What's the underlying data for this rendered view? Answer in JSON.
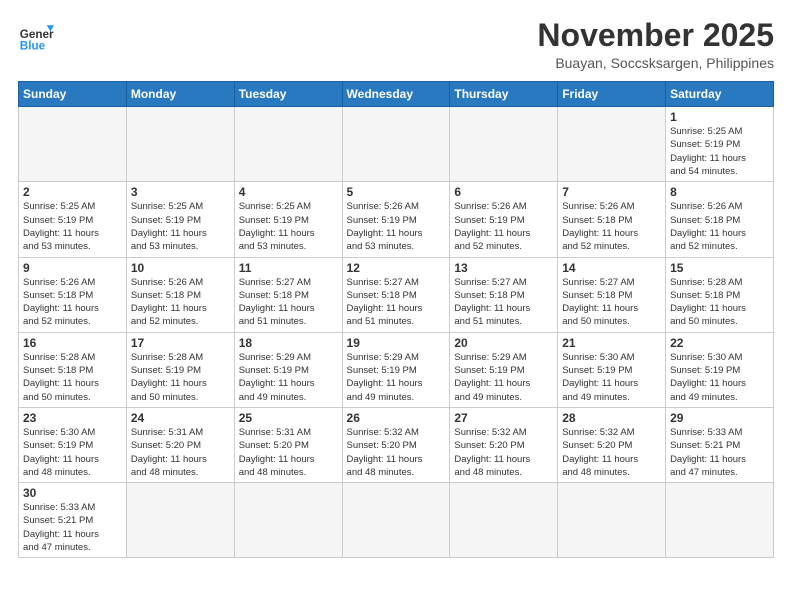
{
  "header": {
    "logo_general": "General",
    "logo_blue": "Blue",
    "month_title": "November 2025",
    "location": "Buayan, Soccsksargen, Philippines"
  },
  "weekdays": [
    "Sunday",
    "Monday",
    "Tuesday",
    "Wednesday",
    "Thursday",
    "Friday",
    "Saturday"
  ],
  "weeks": [
    [
      {
        "day": "",
        "info": ""
      },
      {
        "day": "",
        "info": ""
      },
      {
        "day": "",
        "info": ""
      },
      {
        "day": "",
        "info": ""
      },
      {
        "day": "",
        "info": ""
      },
      {
        "day": "",
        "info": ""
      },
      {
        "day": "1",
        "info": "Sunrise: 5:25 AM\nSunset: 5:19 PM\nDaylight: 11 hours\nand 54 minutes."
      }
    ],
    [
      {
        "day": "2",
        "info": "Sunrise: 5:25 AM\nSunset: 5:19 PM\nDaylight: 11 hours\nand 53 minutes."
      },
      {
        "day": "3",
        "info": "Sunrise: 5:25 AM\nSunset: 5:19 PM\nDaylight: 11 hours\nand 53 minutes."
      },
      {
        "day": "4",
        "info": "Sunrise: 5:25 AM\nSunset: 5:19 PM\nDaylight: 11 hours\nand 53 minutes."
      },
      {
        "day": "5",
        "info": "Sunrise: 5:26 AM\nSunset: 5:19 PM\nDaylight: 11 hours\nand 53 minutes."
      },
      {
        "day": "6",
        "info": "Sunrise: 5:26 AM\nSunset: 5:19 PM\nDaylight: 11 hours\nand 52 minutes."
      },
      {
        "day": "7",
        "info": "Sunrise: 5:26 AM\nSunset: 5:18 PM\nDaylight: 11 hours\nand 52 minutes."
      },
      {
        "day": "8",
        "info": "Sunrise: 5:26 AM\nSunset: 5:18 PM\nDaylight: 11 hours\nand 52 minutes."
      }
    ],
    [
      {
        "day": "9",
        "info": "Sunrise: 5:26 AM\nSunset: 5:18 PM\nDaylight: 11 hours\nand 52 minutes."
      },
      {
        "day": "10",
        "info": "Sunrise: 5:26 AM\nSunset: 5:18 PM\nDaylight: 11 hours\nand 52 minutes."
      },
      {
        "day": "11",
        "info": "Sunrise: 5:27 AM\nSunset: 5:18 PM\nDaylight: 11 hours\nand 51 minutes."
      },
      {
        "day": "12",
        "info": "Sunrise: 5:27 AM\nSunset: 5:18 PM\nDaylight: 11 hours\nand 51 minutes."
      },
      {
        "day": "13",
        "info": "Sunrise: 5:27 AM\nSunset: 5:18 PM\nDaylight: 11 hours\nand 51 minutes."
      },
      {
        "day": "14",
        "info": "Sunrise: 5:27 AM\nSunset: 5:18 PM\nDaylight: 11 hours\nand 50 minutes."
      },
      {
        "day": "15",
        "info": "Sunrise: 5:28 AM\nSunset: 5:18 PM\nDaylight: 11 hours\nand 50 minutes."
      }
    ],
    [
      {
        "day": "16",
        "info": "Sunrise: 5:28 AM\nSunset: 5:18 PM\nDaylight: 11 hours\nand 50 minutes."
      },
      {
        "day": "17",
        "info": "Sunrise: 5:28 AM\nSunset: 5:19 PM\nDaylight: 11 hours\nand 50 minutes."
      },
      {
        "day": "18",
        "info": "Sunrise: 5:29 AM\nSunset: 5:19 PM\nDaylight: 11 hours\nand 49 minutes."
      },
      {
        "day": "19",
        "info": "Sunrise: 5:29 AM\nSunset: 5:19 PM\nDaylight: 11 hours\nand 49 minutes."
      },
      {
        "day": "20",
        "info": "Sunrise: 5:29 AM\nSunset: 5:19 PM\nDaylight: 11 hours\nand 49 minutes."
      },
      {
        "day": "21",
        "info": "Sunrise: 5:30 AM\nSunset: 5:19 PM\nDaylight: 11 hours\nand 49 minutes."
      },
      {
        "day": "22",
        "info": "Sunrise: 5:30 AM\nSunset: 5:19 PM\nDaylight: 11 hours\nand 49 minutes."
      }
    ],
    [
      {
        "day": "23",
        "info": "Sunrise: 5:30 AM\nSunset: 5:19 PM\nDaylight: 11 hours\nand 48 minutes."
      },
      {
        "day": "24",
        "info": "Sunrise: 5:31 AM\nSunset: 5:20 PM\nDaylight: 11 hours\nand 48 minutes."
      },
      {
        "day": "25",
        "info": "Sunrise: 5:31 AM\nSunset: 5:20 PM\nDaylight: 11 hours\nand 48 minutes."
      },
      {
        "day": "26",
        "info": "Sunrise: 5:32 AM\nSunset: 5:20 PM\nDaylight: 11 hours\nand 48 minutes."
      },
      {
        "day": "27",
        "info": "Sunrise: 5:32 AM\nSunset: 5:20 PM\nDaylight: 11 hours\nand 48 minutes."
      },
      {
        "day": "28",
        "info": "Sunrise: 5:32 AM\nSunset: 5:20 PM\nDaylight: 11 hours\nand 48 minutes."
      },
      {
        "day": "29",
        "info": "Sunrise: 5:33 AM\nSunset: 5:21 PM\nDaylight: 11 hours\nand 47 minutes."
      }
    ],
    [
      {
        "day": "30",
        "info": "Sunrise: 5:33 AM\nSunset: 5:21 PM\nDaylight: 11 hours\nand 47 minutes."
      },
      {
        "day": "",
        "info": ""
      },
      {
        "day": "",
        "info": ""
      },
      {
        "day": "",
        "info": ""
      },
      {
        "day": "",
        "info": ""
      },
      {
        "day": "",
        "info": ""
      },
      {
        "day": "",
        "info": ""
      }
    ]
  ]
}
